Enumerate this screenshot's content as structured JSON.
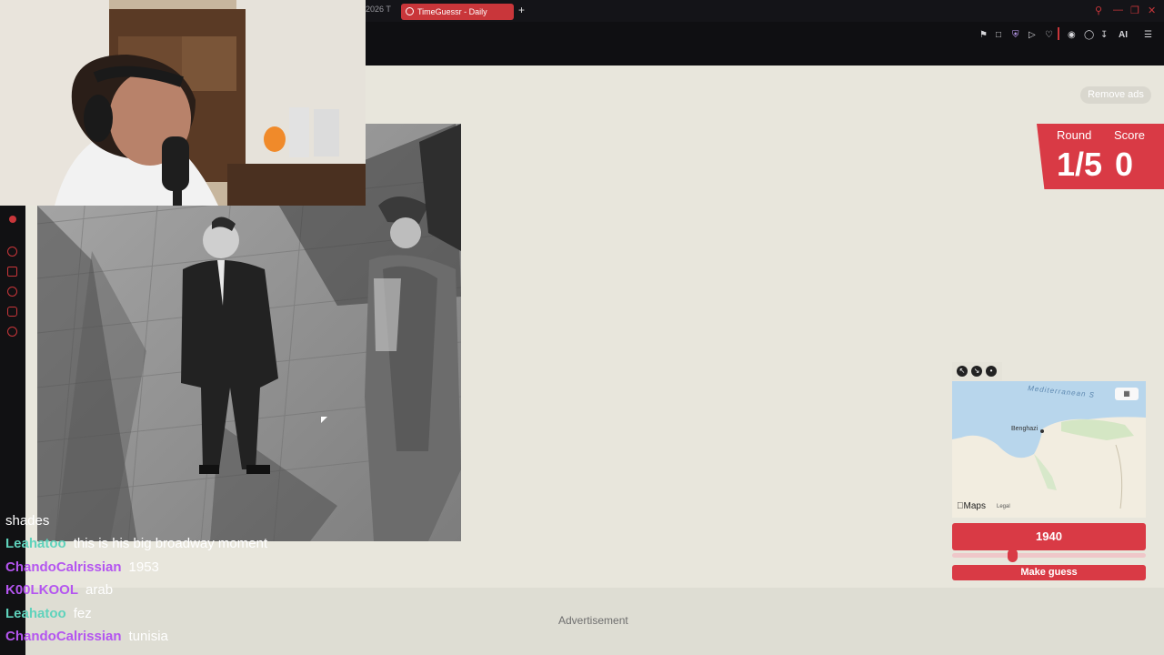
{
  "browser": {
    "partial_tab": "2026 T",
    "active_tab": "TimeGuessr - Daily",
    "new_tab_icon": "plus-icon",
    "window_icons": [
      "search-icon",
      "minimize-icon",
      "restore-icon",
      "close-icon"
    ],
    "toolbar_icons": [
      "pin-icon",
      "screenshot-icon",
      "shield-icon",
      "play-icon",
      "heart-icon",
      "extensions-icon",
      "profile-icon",
      "download-icon"
    ],
    "ai_label": "AI",
    "menu_icon": "hamburger-icon"
  },
  "sidebar": {
    "icons": [
      "notification-icon",
      "target-icon",
      "pin-icon",
      "history-icon",
      "chat-icon",
      "settings-icon"
    ]
  },
  "game": {
    "remove_ads": "Remove ads",
    "round_header": "Round",
    "score_header": "Score",
    "round_value": "1/5",
    "score_value": "0",
    "map": {
      "sea_label": "Mediterranean S",
      "city_label": "Benghazi",
      "brand": "Maps",
      "legal": "Legal",
      "controls": [
        "expand-icon",
        "shrink-icon",
        "pin-icon"
      ],
      "toggle_icon": "map-icon"
    },
    "year_value": "1940",
    "year_fraction": 0.31,
    "guess_button": "Make guess",
    "ad_label": "Advertisement"
  },
  "chat": [
    {
      "user": "",
      "message": "shades",
      "user_color": "#ffffff"
    },
    {
      "user": "Leahatoo",
      "message": "this is his big broadway moment",
      "user_color": "#5fd3bc"
    },
    {
      "user": "ChandoCalrissian",
      "message": "1953",
      "user_color": "#b455f0"
    },
    {
      "user": "K00LKOOL",
      "message": "arab",
      "user_color": "#b455f0"
    },
    {
      "user": "Leahatoo",
      "message": "fez",
      "user_color": "#5fd3bc"
    },
    {
      "user": "ChandoCalrissian",
      "message": "tunisia",
      "user_color": "#b455f0"
    }
  ],
  "colors": {
    "accent": "#d93a45",
    "page_bg": "#e8e6dc",
    "chrome_bg": "#0f0f12"
  }
}
